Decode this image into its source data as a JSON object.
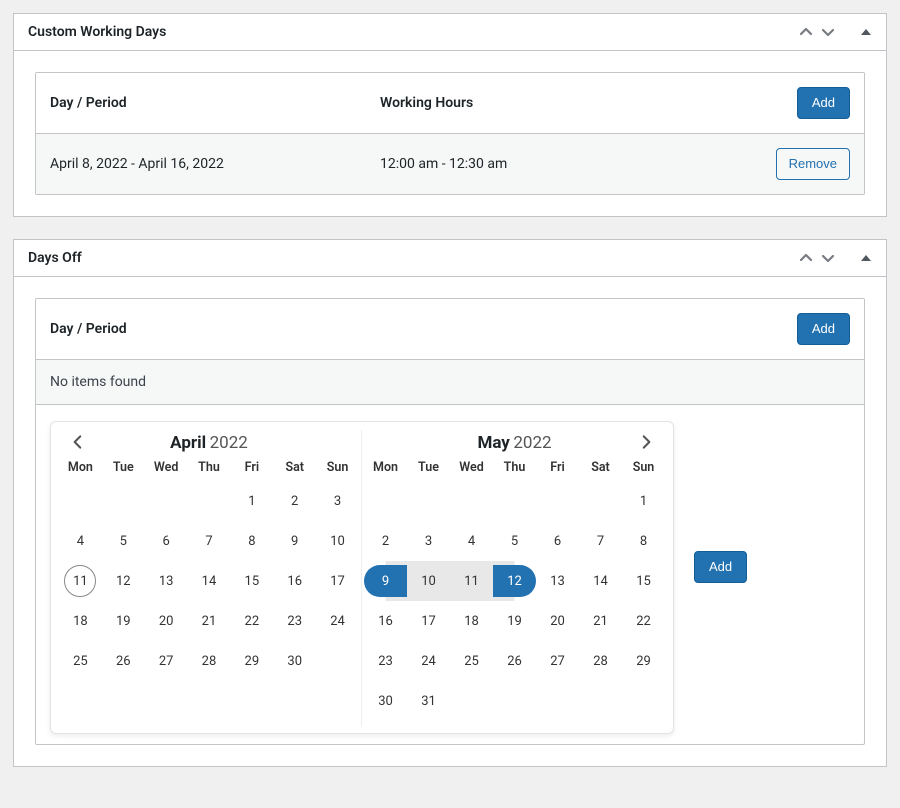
{
  "panels": {
    "custom": {
      "title": "Custom Working Days",
      "col_day": "Day / Period",
      "col_hours": "Working Hours",
      "add_label": "Add",
      "row_day": "April 8, 2022 - April 16, 2022",
      "row_hours": "12:00 am - 12:30 am",
      "remove_label": "Remove"
    },
    "daysoff": {
      "title": "Days Off",
      "col_day": "Day / Period",
      "add_label": "Add",
      "noitems": "No items found",
      "calendar_add": "Add"
    }
  },
  "calendar": {
    "weekdays": [
      "Mon",
      "Tue",
      "Wed",
      "Thu",
      "Fri",
      "Sat",
      "Sun"
    ],
    "left": {
      "month": "April",
      "year": "2022",
      "leading_blanks": 4,
      "days": 30,
      "today": 11
    },
    "right": {
      "month": "May",
      "year": "2022",
      "leading_blanks": 6,
      "days": 31,
      "range_start": 9,
      "range_end": 12
    }
  }
}
